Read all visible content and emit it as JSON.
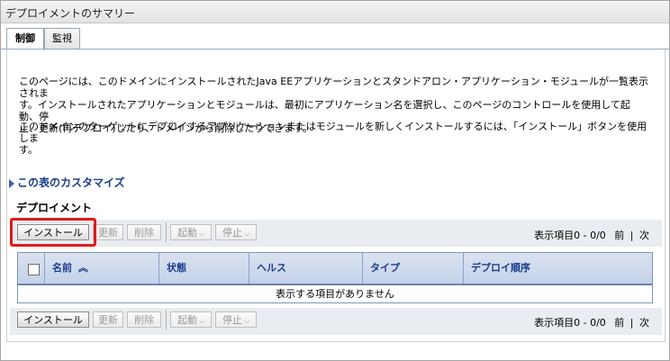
{
  "window": {
    "title": "デプロイメントのサマリー"
  },
  "tabs": [
    {
      "label": "制御",
      "active": true
    },
    {
      "label": "監視",
      "active": false
    }
  ],
  "description": {
    "p1_line1": "このページには、このドメインにインストールされたJava EEアプリケーションとスタンドアロン・アプリケーション・モジュールが一覧表示されま",
    "p1_line2": "す。インストールされたアプリケーションとモジュールは、最初にアプリケーション名を選択し、このページのコントロールを使用して起動、停",
    "p1_line3": "止、更新(再デプロイ)したり、ドメインから削除したりできます。",
    "p2_line1": "このドメインのターゲットにデプロイするアプリケーションまたはモジュールを新しくインストールするには、「インストール」ボタンを使用しま",
    "p2_line2": "す。"
  },
  "customize_link": "この表のカスタマイズ",
  "section_title": "デプロイメント",
  "toolbar": {
    "install": "インストール",
    "update": "更新",
    "delete": "削除",
    "start": "起動",
    "stop": "停止",
    "dropdown_glyph": "⌵"
  },
  "pager": {
    "info": "表示項目0 - 0/0",
    "prev": "前",
    "sep": "|",
    "next": "次"
  },
  "table": {
    "columns": [
      "名前",
      "状態",
      "ヘルス",
      "タイプ",
      "デプロイ順序"
    ],
    "sort_glyph": "︽",
    "empty_message": "表示する項目がありません"
  },
  "colors": {
    "highlight": "#e01b1b",
    "link": "#1a3d8c",
    "header_bg": "#c4d1e8"
  }
}
